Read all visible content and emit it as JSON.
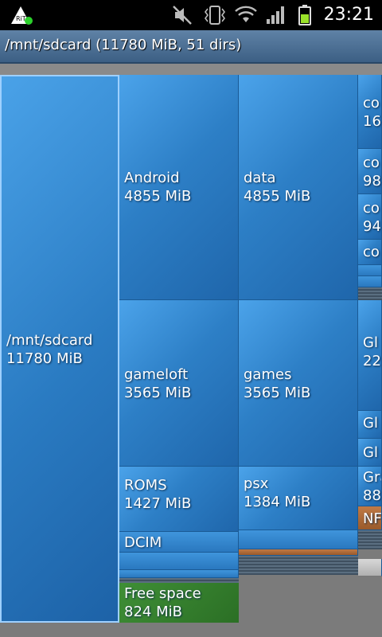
{
  "status_bar": {
    "time": "23:21",
    "icons": [
      "app-icon",
      "mute-icon",
      "vibrate-icon",
      "wifi-icon",
      "signal-icon",
      "battery-icon"
    ]
  },
  "header": {
    "title": "/mnt/sdcard (11780 MiB, 51 dirs)"
  },
  "treemap": {
    "root": {
      "name": "/mnt/sdcard",
      "size": "11780 MiB"
    },
    "android": {
      "name": "Android",
      "size": "4855 MiB"
    },
    "data": {
      "name": "data",
      "size": "4855 MiB"
    },
    "gameloft": {
      "name": "gameloft",
      "size": "3565 MiB"
    },
    "games": {
      "name": "games",
      "size": "3565 MiB"
    },
    "roms": {
      "name": "ROMS",
      "size": "1427 MiB"
    },
    "psx": {
      "name": "psx",
      "size": "1384 MiB"
    },
    "dcim": {
      "name": "DCIM"
    },
    "free": {
      "name": "Free space",
      "size": "824 MiB"
    },
    "col4": [
      "co",
      "16",
      "co",
      "98",
      "co",
      "94",
      "co",
      "Gl",
      "22",
      "Gl",
      "Gl",
      "Gra",
      "88",
      "NF"
    ]
  },
  "colors": {
    "cell": "#2d7fc6",
    "free": "#3f8f36",
    "accent": "#c07a45"
  }
}
